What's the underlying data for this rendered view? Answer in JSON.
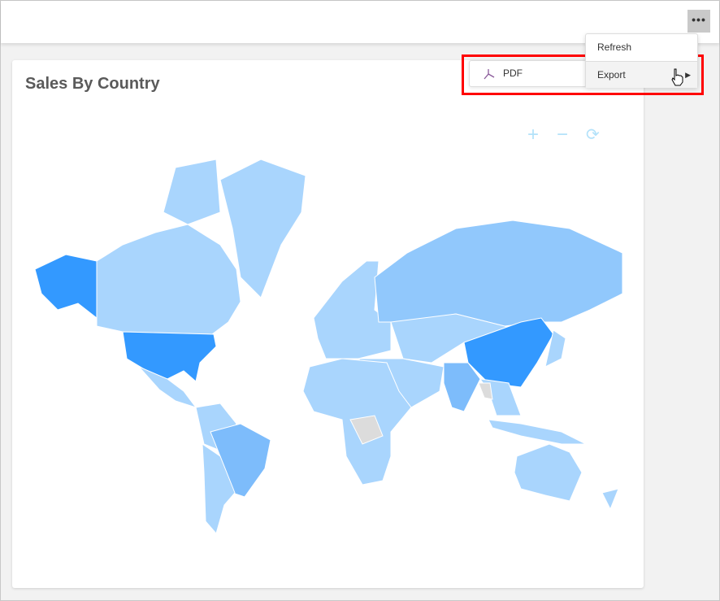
{
  "toolbar": {
    "more_icon": "more-horizontal-icon",
    "more_label": "•••"
  },
  "card": {
    "title": "Sales By Country"
  },
  "map_controls": {
    "zoom_in": "+",
    "zoom_out": "−",
    "reset": "⟳"
  },
  "menu": {
    "items": [
      {
        "label": "Refresh"
      },
      {
        "label": "Export",
        "submenu_arrow": "▶"
      }
    ]
  },
  "submenu": {
    "items": [
      {
        "label": "PDF",
        "icon": "pdf-icon"
      }
    ]
  },
  "colors": {
    "highest": "#3399ff",
    "high": "#7dbcfb",
    "medium": "#91c8fc",
    "low": "#a9d5fd",
    "no_data": "#dcdcdc",
    "highlight": "#ff0000"
  }
}
